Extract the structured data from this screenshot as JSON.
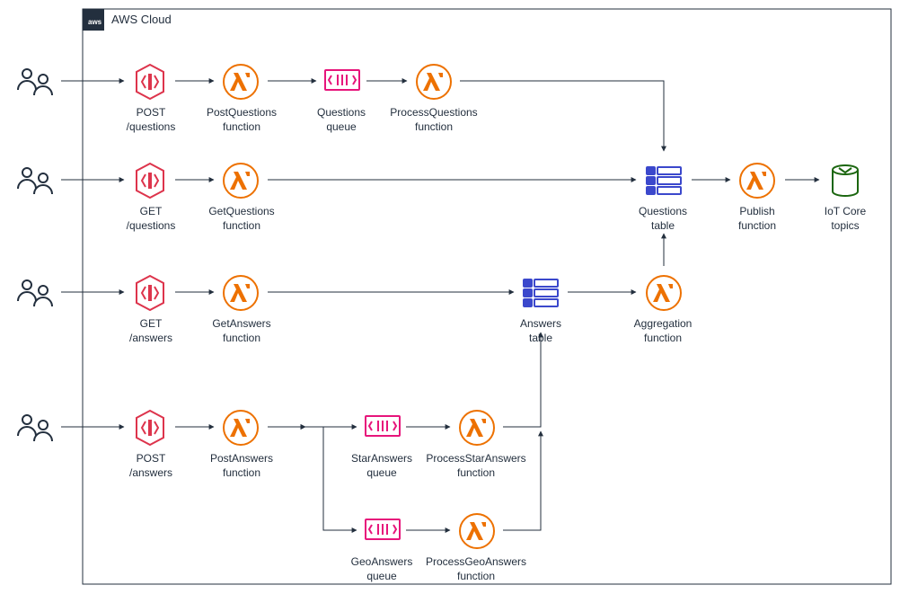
{
  "title": "AWS Cloud",
  "colors": {
    "lambda": "#ED7100",
    "api": "#E7157B",
    "sqs": "#E7157B",
    "dynamo": "#3B48CC",
    "iot": "#1B660F",
    "border": "#232F3E",
    "users": "#232F3E",
    "gateway": "#E7157B",
    "apiRed": "#DD344C"
  },
  "nodes": {
    "users1": {
      "label": ""
    },
    "users2": {
      "label": ""
    },
    "users3": {
      "label": ""
    },
    "users4": {
      "label": ""
    },
    "api_post_q": {
      "l1": "POST",
      "l2": "/questions"
    },
    "api_get_q": {
      "l1": "GET",
      "l2": "/questions"
    },
    "api_get_a": {
      "l1": "GET",
      "l2": "/answers"
    },
    "api_post_a": {
      "l1": "POST",
      "l2": "/answers"
    },
    "fn_post_q": {
      "l1": "PostQuestions",
      "l2": "function"
    },
    "fn_get_q": {
      "l1": "GetQuestions",
      "l2": "function"
    },
    "fn_get_a": {
      "l1": "GetAnswers",
      "l2": "function"
    },
    "fn_post_a": {
      "l1": "PostAnswers",
      "l2": "function"
    },
    "q_questions": {
      "l1": "Questions",
      "l2": "queue"
    },
    "q_star": {
      "l1": "StarAnswers",
      "l2": "queue"
    },
    "q_geo": {
      "l1": "GeoAnswers",
      "l2": "queue"
    },
    "fn_proc_q": {
      "l1": "ProcessQuestions",
      "l2": "function"
    },
    "fn_proc_star": {
      "l1": "ProcessStarAnswers",
      "l2": "function"
    },
    "fn_proc_geo": {
      "l1": "ProcessGeoAnswers",
      "l2": "function"
    },
    "tbl_answers": {
      "l1": "Answers",
      "l2": "table"
    },
    "tbl_questions": {
      "l1": "Questions",
      "l2": "table"
    },
    "fn_agg": {
      "l1": "Aggregation",
      "l2": "function"
    },
    "fn_publish": {
      "l1": "Publish",
      "l2": "function"
    },
    "iot": {
      "l1": "IoT Core",
      "l2": "topics"
    }
  },
  "chart_data": {
    "type": "diagram",
    "title": "AWS Cloud",
    "nodes": [
      {
        "id": "users1",
        "type": "users"
      },
      {
        "id": "users2",
        "type": "users"
      },
      {
        "id": "users3",
        "type": "users"
      },
      {
        "id": "users4",
        "type": "users"
      },
      {
        "id": "api_post_q",
        "type": "api-gateway",
        "label": "POST /questions"
      },
      {
        "id": "api_get_q",
        "type": "api-gateway",
        "label": "GET /questions"
      },
      {
        "id": "api_get_a",
        "type": "api-gateway",
        "label": "GET /answers"
      },
      {
        "id": "api_post_a",
        "type": "api-gateway",
        "label": "POST /answers"
      },
      {
        "id": "fn_post_q",
        "type": "lambda",
        "label": "PostQuestions function"
      },
      {
        "id": "fn_get_q",
        "type": "lambda",
        "label": "GetQuestions function"
      },
      {
        "id": "fn_get_a",
        "type": "lambda",
        "label": "GetAnswers function"
      },
      {
        "id": "fn_post_a",
        "type": "lambda",
        "label": "PostAnswers function"
      },
      {
        "id": "q_questions",
        "type": "sqs",
        "label": "Questions queue"
      },
      {
        "id": "q_star",
        "type": "sqs",
        "label": "StarAnswers queue"
      },
      {
        "id": "q_geo",
        "type": "sqs",
        "label": "GeoAnswers queue"
      },
      {
        "id": "fn_proc_q",
        "type": "lambda",
        "label": "ProcessQuestions function"
      },
      {
        "id": "fn_proc_star",
        "type": "lambda",
        "label": "ProcessStarAnswers function"
      },
      {
        "id": "fn_proc_geo",
        "type": "lambda",
        "label": "ProcessGeoAnswers function"
      },
      {
        "id": "tbl_answers",
        "type": "dynamodb",
        "label": "Answers table"
      },
      {
        "id": "tbl_questions",
        "type": "dynamodb",
        "label": "Questions table"
      },
      {
        "id": "fn_agg",
        "type": "lambda",
        "label": "Aggregation function"
      },
      {
        "id": "fn_publish",
        "type": "lambda",
        "label": "Publish function"
      },
      {
        "id": "iot",
        "type": "iot-core",
        "label": "IoT Core topics"
      }
    ],
    "edges": [
      [
        "users1",
        "api_post_q"
      ],
      [
        "api_post_q",
        "fn_post_q"
      ],
      [
        "fn_post_q",
        "q_questions"
      ],
      [
        "q_questions",
        "fn_proc_q"
      ],
      [
        "fn_proc_q",
        "tbl_questions"
      ],
      [
        "users2",
        "api_get_q"
      ],
      [
        "api_get_q",
        "fn_get_q"
      ],
      [
        "fn_get_q",
        "tbl_questions"
      ],
      [
        "users3",
        "api_get_a"
      ],
      [
        "api_get_a",
        "fn_get_a"
      ],
      [
        "fn_get_a",
        "tbl_answers"
      ],
      [
        "users4",
        "api_post_a"
      ],
      [
        "api_post_a",
        "fn_post_a"
      ],
      [
        "fn_post_a",
        "q_star"
      ],
      [
        "fn_post_a",
        "q_geo"
      ],
      [
        "q_star",
        "fn_proc_star"
      ],
      [
        "q_geo",
        "fn_proc_geo"
      ],
      [
        "fn_proc_star",
        "tbl_answers"
      ],
      [
        "fn_proc_geo",
        "tbl_answers"
      ],
      [
        "tbl_answers",
        "fn_agg"
      ],
      [
        "fn_agg",
        "tbl_questions"
      ],
      [
        "tbl_questions",
        "fn_publish"
      ],
      [
        "fn_publish",
        "iot"
      ]
    ]
  }
}
